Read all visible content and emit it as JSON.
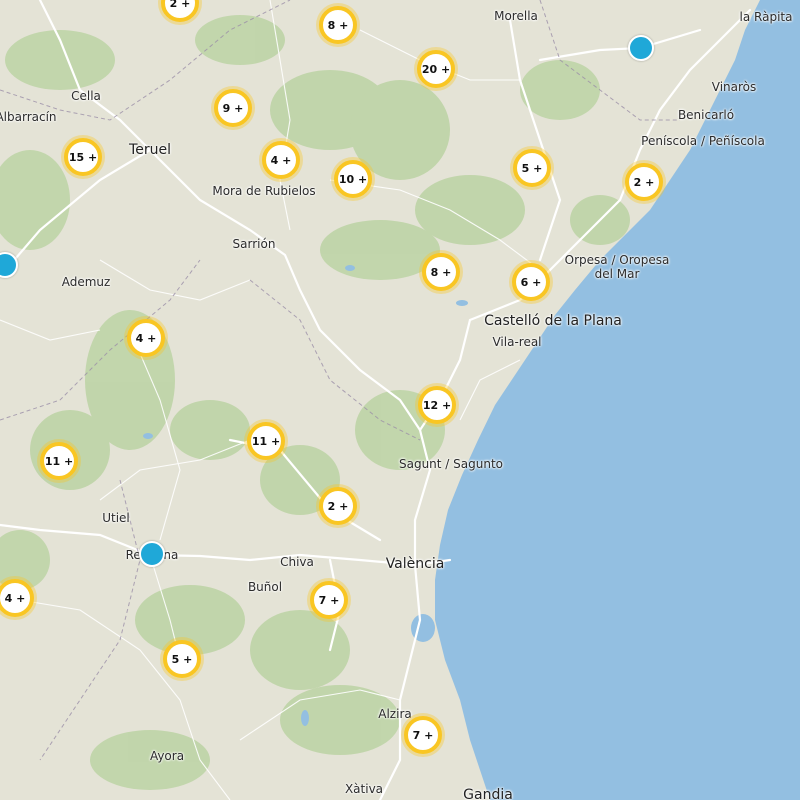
{
  "colors": {
    "land": "#e4e3d6",
    "sea": "#93bfe1",
    "forest": "#bcd3a4",
    "road": "#ffffff",
    "cluster_ring": "#f9c623",
    "marker": "#1fa8d8"
  },
  "places": [
    {
      "id": "morella",
      "label": "Morella"
    },
    {
      "id": "la-rapita",
      "label": "la Ràpita"
    },
    {
      "id": "vinaros",
      "label": "Vinaròs"
    },
    {
      "id": "benicarlo",
      "label": "Benicarló"
    },
    {
      "id": "peniscola",
      "label": "Peníscola / Peñíscola"
    },
    {
      "id": "cella",
      "label": "Cella"
    },
    {
      "id": "albarracin",
      "label": "Albarracín"
    },
    {
      "id": "teruel",
      "label": "Teruel"
    },
    {
      "id": "mora-de-rubielos",
      "label": "Mora de Rubielos"
    },
    {
      "id": "sarrion",
      "label": "Sarrión"
    },
    {
      "id": "ademuz",
      "label": "Ademuz"
    },
    {
      "id": "orpesa",
      "label": "Orpesa / Oropesa\ndel Mar"
    },
    {
      "id": "castello",
      "label": "Castelló de la Plana"
    },
    {
      "id": "vila-real",
      "label": "Vila-real"
    },
    {
      "id": "sagunt",
      "label": "Sagunt / Sagunto"
    },
    {
      "id": "utiel",
      "label": "Utiel"
    },
    {
      "id": "requena",
      "label": "Requena"
    },
    {
      "id": "chiva",
      "label": "Chiva"
    },
    {
      "id": "valencia",
      "label": "València"
    },
    {
      "id": "bunol",
      "label": "Buñol"
    },
    {
      "id": "alzira",
      "label": "Alzira"
    },
    {
      "id": "ayora",
      "label": "Ayora"
    },
    {
      "id": "xativa",
      "label": "Xàtiva"
    },
    {
      "id": "gandia",
      "label": "Gandia"
    }
  ],
  "clusters": [
    {
      "label": "2 +"
    },
    {
      "label": "8 +"
    },
    {
      "label": "20 +"
    },
    {
      "label": "9 +"
    },
    {
      "label": "15 +"
    },
    {
      "label": "4 +"
    },
    {
      "label": "10 +"
    },
    {
      "label": "5 +"
    },
    {
      "label": "2 +"
    },
    {
      "label": "8 +"
    },
    {
      "label": "6 +"
    },
    {
      "label": "4 +"
    },
    {
      "label": "12 +"
    },
    {
      "label": "11 +"
    },
    {
      "label": "11 +"
    },
    {
      "label": "2 +"
    },
    {
      "label": "7 +"
    },
    {
      "label": "4 +"
    },
    {
      "label": "5 +"
    },
    {
      "label": "7 +"
    }
  ],
  "markers": [
    {
      "id": "marker-north"
    },
    {
      "id": "marker-west"
    },
    {
      "id": "marker-requena"
    }
  ]
}
